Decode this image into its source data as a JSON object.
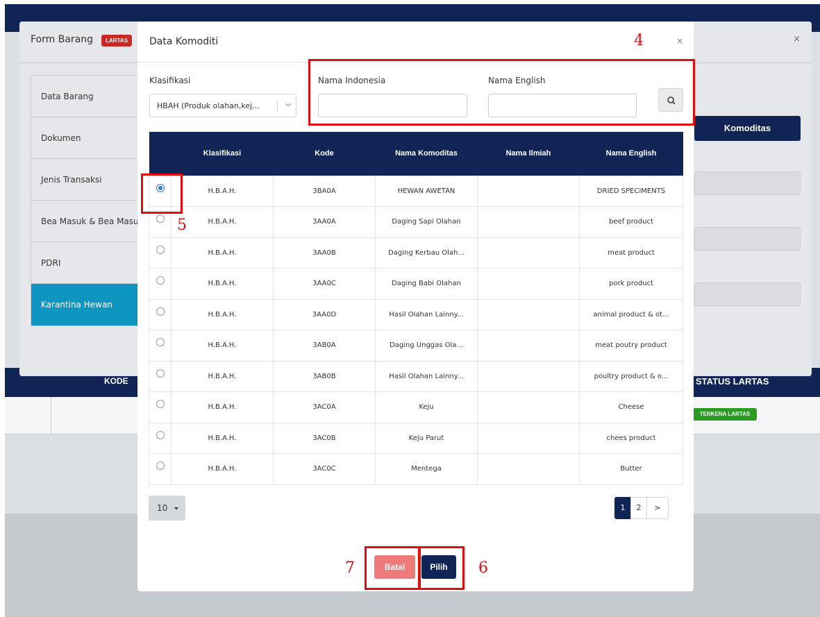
{
  "background": {
    "table_header": {
      "kode": "KODE",
      "status_lartas": "STATUS LARTAS"
    },
    "badge": "TERKENA LARTAS"
  },
  "form_modal": {
    "title": "Form Barang",
    "tag": "LARTAS",
    "close": "×",
    "menu": [
      {
        "label": "Data Barang"
      },
      {
        "label": "Dokumen"
      },
      {
        "label": "Jenis Transaksi"
      },
      {
        "label": "Bea Masuk & Bea Masuk"
      },
      {
        "label": "PDRI"
      },
      {
        "label": "Karantina Hewan"
      }
    ],
    "komoditas_button": "Komoditas"
  },
  "dialog": {
    "title": "Data Komoditi",
    "close": "×",
    "filters": {
      "klasifikasi_label": "Klasifikasi",
      "klasifikasi_value": "HBAH (Produk olahan,kej...",
      "nama_indonesia_label": "Nama Indonesia",
      "nama_indonesia_value": "",
      "nama_english_label": "Nama English",
      "nama_english_value": ""
    },
    "table": {
      "headers": [
        "",
        "Klasifikasi",
        "Kode",
        "Nama Komoditas",
        "Nama Ilmiah",
        "Nama English"
      ],
      "rows": [
        {
          "selected": true,
          "klasifikasi": "H.B.A.H.",
          "kode": "3BA0A",
          "nama": "HEWAN AWETAN",
          "ilmiah": "",
          "english": "DRIED SPECIMENTS"
        },
        {
          "selected": false,
          "klasifikasi": "H.B.A.H.",
          "kode": "3AA0A",
          "nama": "Daging Sapi Olahan",
          "ilmiah": "",
          "english": "beef product"
        },
        {
          "selected": false,
          "klasifikasi": "H.B.A.H.",
          "kode": "3AA0B",
          "nama": "Daging Kerbau Olah...",
          "ilmiah": "",
          "english": "meat product"
        },
        {
          "selected": false,
          "klasifikasi": "H.B.A.H.",
          "kode": "3AA0C",
          "nama": "Daging Babi Olahan",
          "ilmiah": "",
          "english": "pork product"
        },
        {
          "selected": false,
          "klasifikasi": "H.B.A.H.",
          "kode": "3AA0D",
          "nama": "Hasil Olahan Lainny...",
          "ilmiah": "",
          "english": "animal product & ot..."
        },
        {
          "selected": false,
          "klasifikasi": "H.B.A.H.",
          "kode": "3AB0A",
          "nama": "Daging Unggas Ola...",
          "ilmiah": "",
          "english": "meat poutry product"
        },
        {
          "selected": false,
          "klasifikasi": "H.B.A.H.",
          "kode": "3AB0B",
          "nama": "Hasil Olahan Lainny...",
          "ilmiah": "",
          "english": "poultry product & o..."
        },
        {
          "selected": false,
          "klasifikasi": "H.B.A.H.",
          "kode": "3AC0A",
          "nama": "Keju",
          "ilmiah": "",
          "english": "Cheese"
        },
        {
          "selected": false,
          "klasifikasi": "H.B.A.H.",
          "kode": "3AC0B",
          "nama": "Keju Parut",
          "ilmiah": "",
          "english": "chees product"
        },
        {
          "selected": false,
          "klasifikasi": "H.B.A.H.",
          "kode": "3AC0C",
          "nama": "Mentega",
          "ilmiah": "",
          "english": "Butter"
        }
      ]
    },
    "page_size": "10",
    "pagination": [
      "1",
      "2",
      ">"
    ],
    "buttons": {
      "batal": "Batal",
      "pilih": "Pilih"
    }
  },
  "annotations": [
    "4",
    "5",
    "6",
    "7"
  ],
  "colors": {
    "navy": "#102456",
    "accent_cyan": "#0e95c0",
    "lartas_red": "#c72a26",
    "annotation_red": "#e10d0d",
    "batal_pink": "#ee7a7a",
    "badge_green": "#2b9a22"
  }
}
